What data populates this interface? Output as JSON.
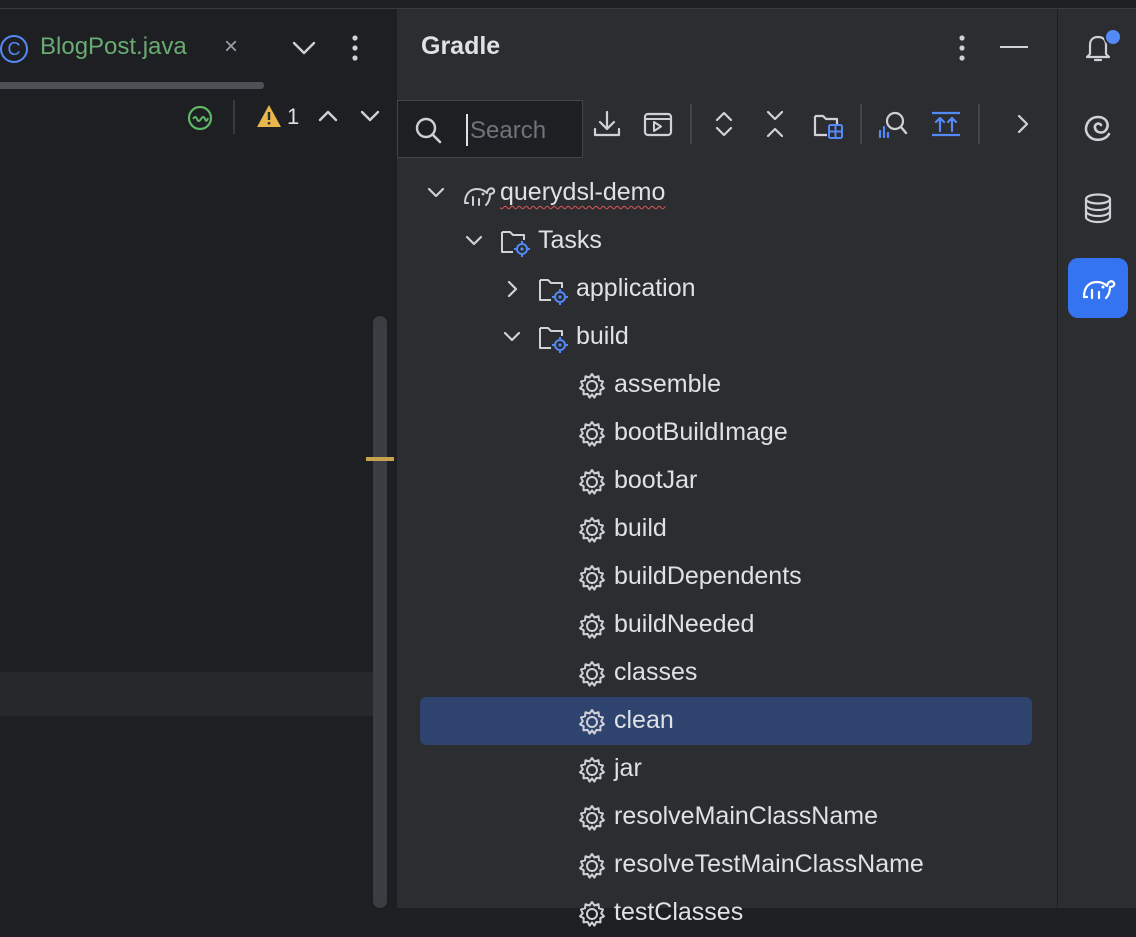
{
  "editor": {
    "tab": {
      "icon_letter": "C",
      "label": "BlogPost.java",
      "close_glyph": "×"
    },
    "inspections": {
      "warning_count": "1"
    }
  },
  "gradle": {
    "title": "Gradle",
    "search": {
      "placeholder": "Search",
      "value": ""
    },
    "toolbar": [
      "download-sources-icon",
      "execute-task-icon",
      "expand-all-icon",
      "collapse-all-icon",
      "link-project-icon",
      "analyze-dependencies-icon",
      "build-scripts-icon",
      "more-chevron-icon"
    ],
    "tree": {
      "project": "querydsl-demo",
      "tasks_label": "Tasks",
      "groups": [
        {
          "label": "application",
          "expanded": false
        },
        {
          "label": "build",
          "expanded": true
        }
      ],
      "build_tasks": [
        "assemble",
        "bootBuildImage",
        "bootJar",
        "build",
        "buildDependents",
        "buildNeeded",
        "classes",
        "clean",
        "jar",
        "resolveMainClassName",
        "resolveTestMainClassName",
        "testClasses"
      ],
      "selected_task": "clean"
    }
  },
  "right_stripe": {
    "items": [
      "notifications-icon",
      "ai-assistant-icon",
      "database-icon",
      "gradle-icon"
    ],
    "active": "gradle-icon"
  },
  "colors": {
    "accent": "#3574f0",
    "selection": "#2e436e",
    "file_name_green": "#6aab73",
    "warning_yellow": "#e8b64a"
  }
}
